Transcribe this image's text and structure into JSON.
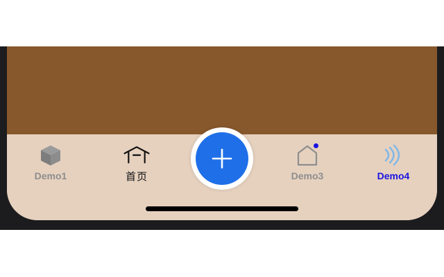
{
  "colors": {
    "content_bg": "#87582c",
    "tabbar_bg": "#e6d1bf",
    "inactive": "#8e8e8e",
    "active": "#1a14e0",
    "active_icon": "#7fb8e8",
    "badge": "#1a14e0",
    "plus_bg": "#1f6fe8",
    "home_text": "#111111"
  },
  "tabs": [
    {
      "label": "Demo1",
      "icon": "cube-icon",
      "state": "inactive"
    },
    {
      "label": "首页",
      "icon": "home-roof-icon",
      "state": "normal"
    },
    {
      "label": "Demo3",
      "icon": "house-outline-icon",
      "state": "inactive",
      "badge": true
    },
    {
      "label": "Demo4",
      "icon": "signal-waves-icon",
      "state": "active"
    }
  ],
  "center_button": {
    "icon": "plus-icon"
  }
}
